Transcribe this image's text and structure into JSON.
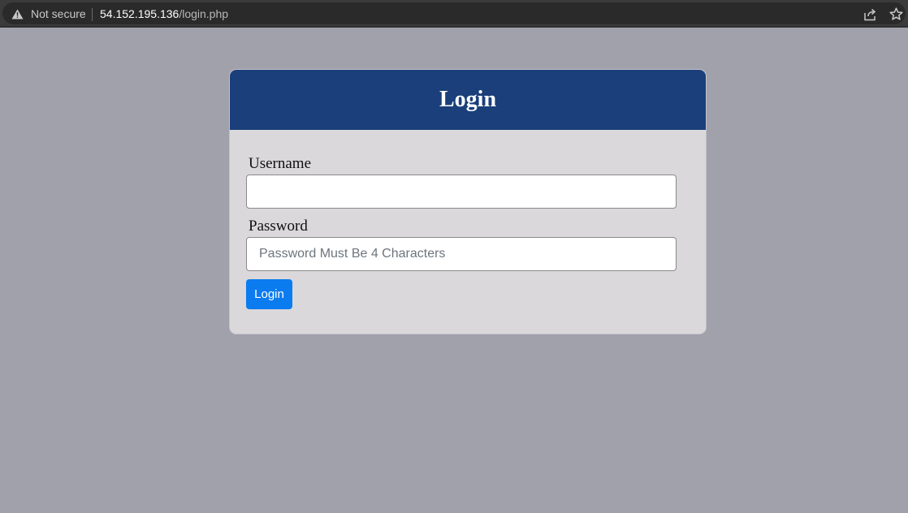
{
  "browser": {
    "security_label": "Not secure",
    "url_host": "54.152.195.136",
    "url_path": "/login.php",
    "icons": [
      "warning-icon",
      "share-icon",
      "star-icon"
    ]
  },
  "login_form": {
    "title": "Login",
    "username_label": "Username",
    "username_value": "",
    "username_placeholder": "",
    "password_label": "Password",
    "password_value": "",
    "password_placeholder": "Password Must Be 4 Characters",
    "submit_label": "Login"
  },
  "colors": {
    "page_background": "#a1a1ac",
    "card_header": "#1a3f7a",
    "card_body": "#dad8da",
    "submit_button": "#0b7bf0"
  }
}
